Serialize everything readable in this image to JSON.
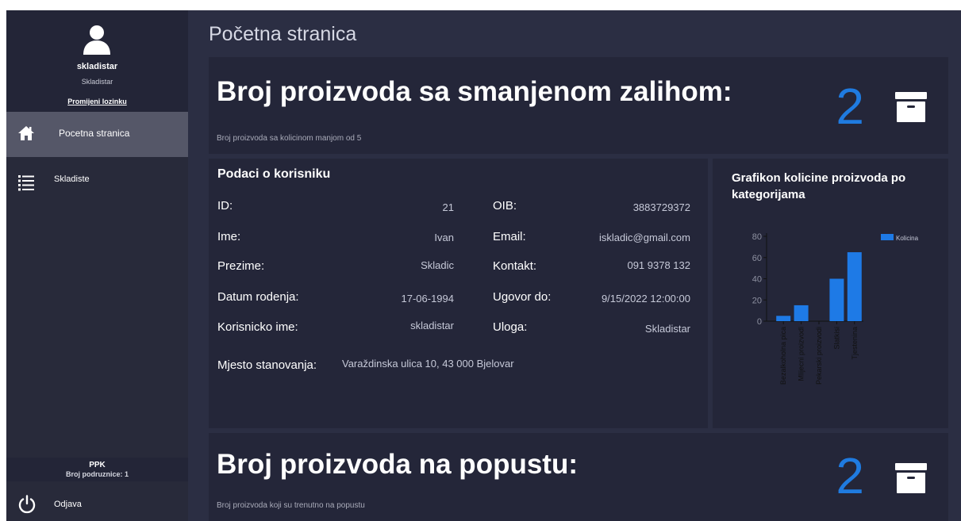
{
  "user": {
    "username": "skladistar",
    "role": "Skladistar",
    "change_password": "Promijeni lozinku"
  },
  "nav": {
    "home_label": "Pocetna stranica",
    "warehouse_label": "Skladiste"
  },
  "branch": {
    "name": "PPK",
    "count_text": "Broj podruznice: 1"
  },
  "logout_label": "Odjava",
  "page_title": "Početna stranica",
  "low_stock": {
    "title": "Broj proizvoda sa smanjenom zalihom:",
    "subtitle": "Broj proizvoda sa kolicinom manjom od 5",
    "count": "2",
    "icon": "archive-box-icon"
  },
  "discount": {
    "title": "Broj proizvoda na popustu:",
    "subtitle": "Broj proizvoda koji su trenutno na popustu",
    "count": "2",
    "icon": "archive-box-icon"
  },
  "user_info": {
    "heading": "Podaci o korisniku",
    "id_label": "ID:",
    "id_value": "21",
    "name_label": "Ime:",
    "name_value": "Ivan",
    "surname_label": "Prezime:",
    "surname_value": "Skladic",
    "dob_label": "Datum rodenja:",
    "dob_value": "17-06-1994",
    "login_label": "Korisnicko ime:",
    "login_value": "skladistar",
    "oib_label": "OIB:",
    "oib_value": "3883729372",
    "email_label": "Email:",
    "email_value": "iskladic@gmail.com",
    "contact_label": "Kontakt:",
    "contact_value": "091 9378 132",
    "contract_label": "Ugovor do:",
    "contract_value": "9/15/2022 12:00:00",
    "role_label": "Uloga:",
    "role_value": "Skladistar",
    "address_label": "Mjesto stanovanja:",
    "address_value": "Varaždinska ulica 10, 43 000 Bjelovar"
  },
  "chart_title": "Grafikon kolicine proizvoda po kategorijama",
  "chart_data": {
    "type": "bar",
    "categories": [
      "Bezalkoholna pica",
      "Mlijecni proizvodi",
      "Pekarski proizvodi",
      "Slatkisi",
      "Tjestenina"
    ],
    "series": [
      {
        "name": "Kolicina",
        "values": [
          5,
          15,
          0,
          40,
          65
        ]
      }
    ],
    "ylim": [
      0,
      80
    ],
    "yticks": [
      0,
      20,
      40,
      60,
      80
    ],
    "legend": "top-right",
    "color": "#1e7ae6",
    "grid": false
  },
  "colors": {
    "accent": "#1f7be0",
    "sidebar": "#282a3a",
    "card": "#242639",
    "background": "#2b2e43"
  }
}
